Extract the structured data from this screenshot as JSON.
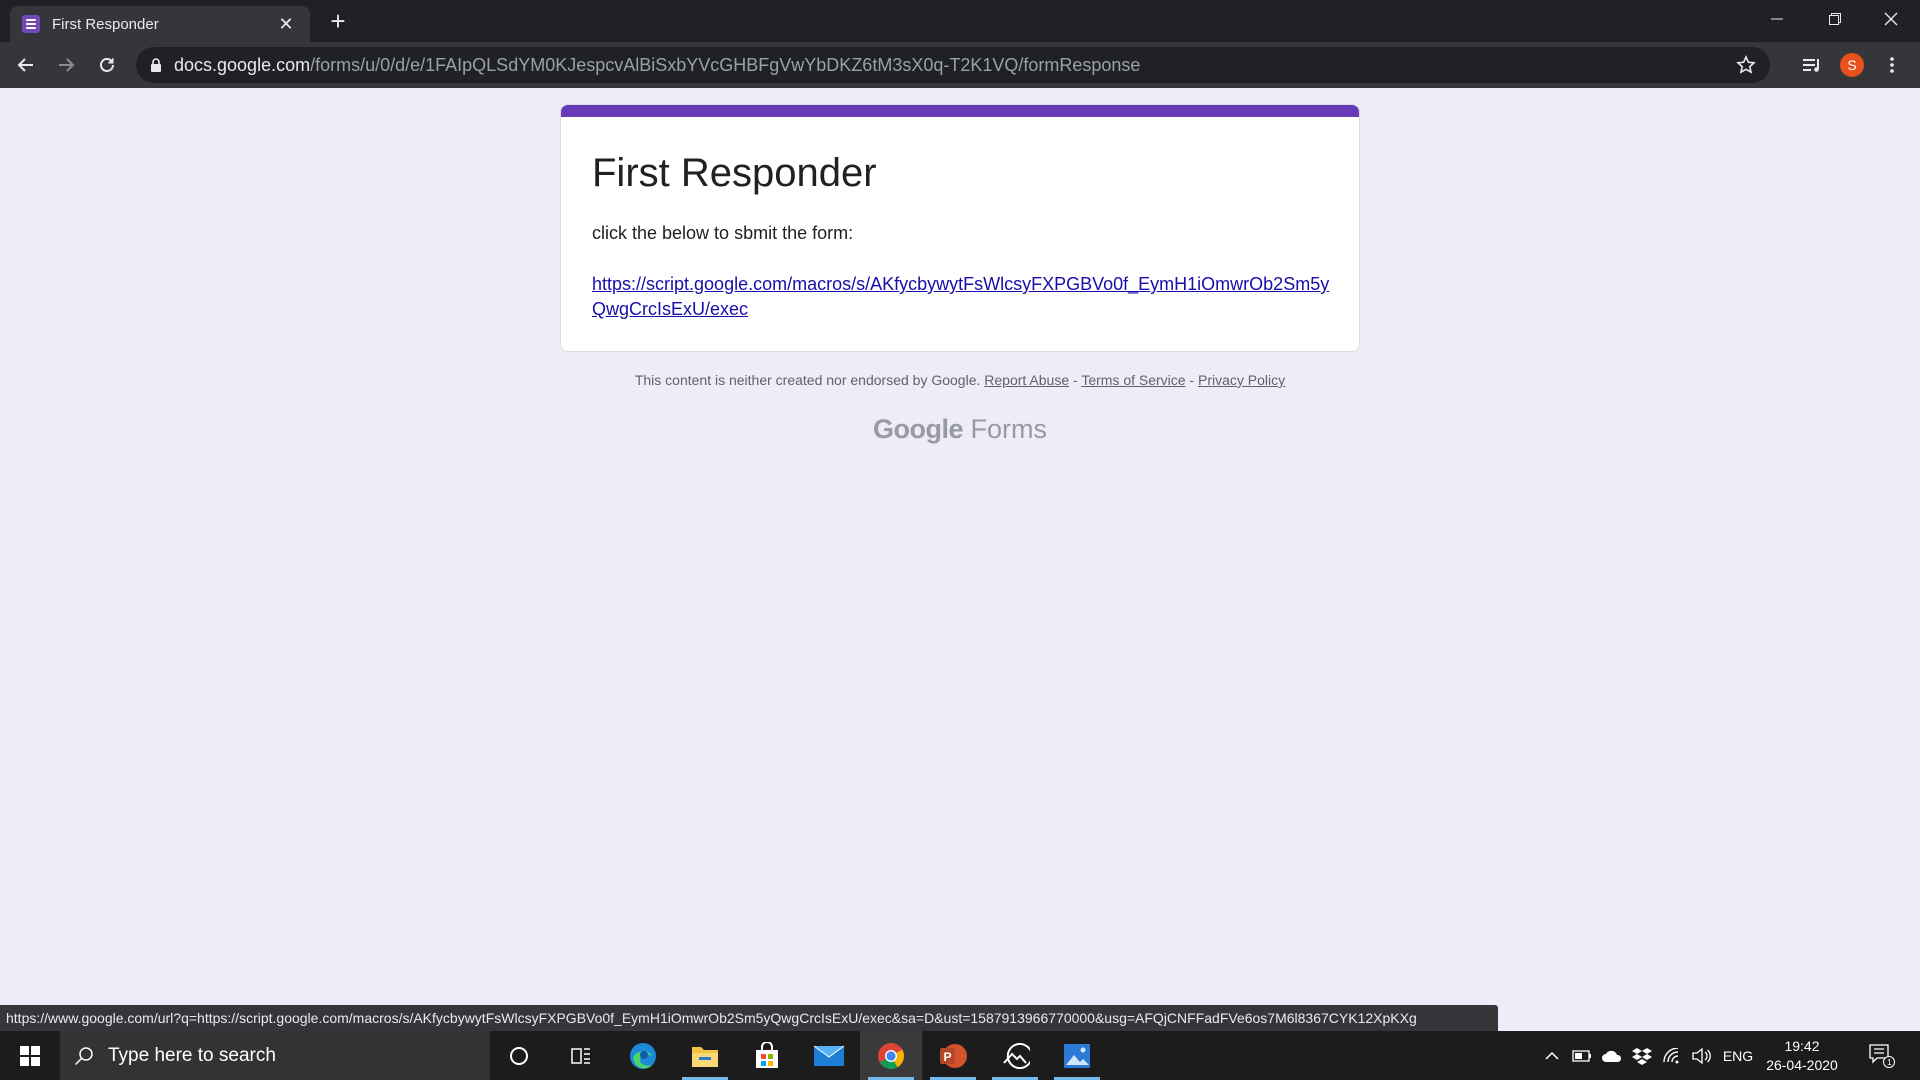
{
  "browser": {
    "tab_title": "First Responder",
    "url_host": "docs.google.com",
    "url_path": "/forms/u/0/d/e/1FAIpQLSdYM0KJespcvAlBiSxbYVcGHBFgVwYbDKZ6tM3sX0q-T2K1VQ/formResponse",
    "profile_initial": "S",
    "status_url": "https://www.google.com/url?q=https://script.google.com/macros/s/AKfycbywytFsWlcsyFXPGBVo0f_EymH1iOmwrOb2Sm5yQwgCrcIsExU/exec&sa=D&ust=1587913966770000&usg=AFQjCNFFadFVe6os7M6l8367CYK12XpKXg"
  },
  "form": {
    "title": "First Responder",
    "description": "click the below to sbmit the form:",
    "link_text": "https://script.google.com/macros/s/AKfycbywytFsWlcsyFXPGBVo0f_EymH1iOmwrOb2Sm5yQwgCrcIsExU/exec",
    "accent_color": "#673ab7"
  },
  "footer": {
    "disclaimer": "This content is neither created nor endorsed by Google.",
    "report_abuse": "Report Abuse",
    "sep1": " - ",
    "terms": "Terms of Service",
    "sep2": " - ",
    "privacy": "Privacy Policy",
    "logo_google": "Google",
    "logo_forms": "Forms"
  },
  "taskbar": {
    "search_placeholder": "Type here to search",
    "language": "ENG",
    "time": "19:42",
    "date": "26-04-2020",
    "notification_count": "1",
    "apps": [
      "cortana",
      "task-view",
      "edge",
      "file-explorer",
      "store",
      "mail",
      "chrome",
      "powerpoint",
      "photos-edit",
      "photos"
    ]
  }
}
